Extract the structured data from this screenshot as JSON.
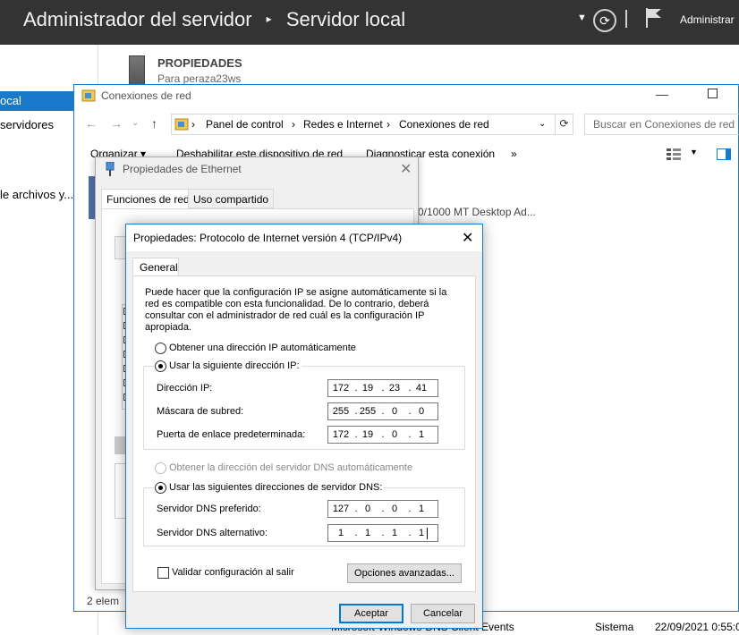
{
  "server_manager": {
    "app_title": "Administrador del servidor",
    "separator": "▸",
    "page": "Servidor local",
    "user_menu": "Administrar",
    "nav": {
      "local": "ocal",
      "servers": "servidores",
      "files": "le archivos y..."
    },
    "properties_title": "PROPIEDADES",
    "properties_sub": "Para peraza23ws",
    "event_row": {
      "source": "Microsoft-Windows-DNS Client Events",
      "log": "Sistema",
      "date": "22/09/2021 0:55:0"
    }
  },
  "network_connections": {
    "title": "Conexiones de red",
    "breadcrumb": [
      "Panel de control",
      "Redes e Internet",
      "Conexiones de red"
    ],
    "search_placeholder": "Buscar en Conexiones de red",
    "commands": [
      "Organizar ▾",
      "Deshabilitar este dispositivo de red",
      "Diagnosticar esta conexión",
      "»"
    ],
    "adapter_desc": "0/1000 MT Desktop Ad...",
    "status": "2 elem"
  },
  "ethernet_properties": {
    "title": "Propiedades de Ethernet",
    "tabs": [
      "Funciones de red",
      "Uso compartido"
    ]
  },
  "ipv4_dialog": {
    "title": "Propiedades: Protocolo de Internet versión 4 (TCP/IPv4)",
    "tab": "General",
    "intro": "Puede hacer que la configuración IP se asigne automáticamente si la red es compatible con esta funcionalidad. De lo contrario, deberá consultar con el administrador de red cuál es la configuración IP apropiada.",
    "ip_auto_label": "Obtener una dirección IP automáticamente",
    "ip_manual_label": "Usar la siguiente dirección IP:",
    "ip_address_label": "Dirección IP:",
    "ip_address": [
      "172",
      "19",
      "23",
      "41"
    ],
    "subnet_label": "Máscara de subred:",
    "subnet": [
      "255",
      "255",
      "0",
      "0"
    ],
    "gateway_label": "Puerta de enlace predeterminada:",
    "gateway": [
      "172",
      "19",
      "0",
      "1"
    ],
    "dns_auto_label": "Obtener la dirección del servidor DNS automáticamente",
    "dns_manual_label": "Usar las siguientes direcciones de servidor DNS:",
    "dns_pref_label": "Servidor DNS preferido:",
    "dns_pref": [
      "127",
      "0",
      "0",
      "1"
    ],
    "dns_alt_label": "Servidor DNS alternativo:",
    "dns_alt": [
      "1",
      "1",
      "1",
      "1"
    ],
    "validate_label": "Validar configuración al salir",
    "advanced_button": "Opciones avanzadas...",
    "ok_button": "Aceptar",
    "cancel_button": "Cancelar"
  }
}
